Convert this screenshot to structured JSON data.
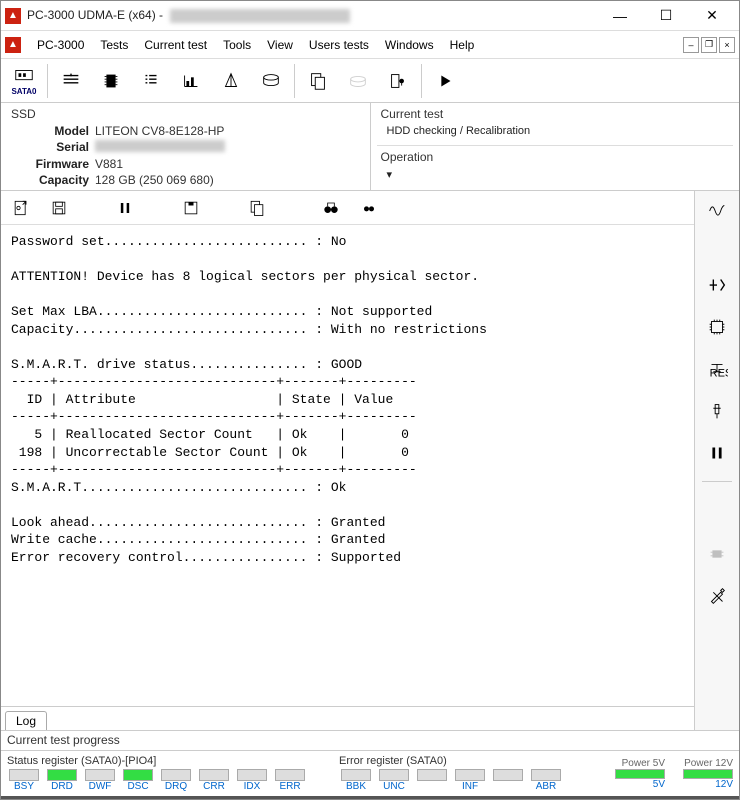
{
  "window": {
    "title_prefix": "PC-3000 UDMA-E (x64) - "
  },
  "menu": {
    "app": "PC-3000",
    "items": [
      "Tests",
      "Current test",
      "Tools",
      "View",
      "Users tests",
      "Windows",
      "Help"
    ]
  },
  "toolbar": {
    "port_label": "SATA0"
  },
  "ssd": {
    "header": "SSD",
    "model_label": "Model",
    "model": "LITEON CV8-8E128-HP",
    "serial_label": "Serial",
    "firmware_label": "Firmware",
    "firmware": "V881",
    "capacity_label": "Capacity",
    "capacity": "128 GB (250 069 680)"
  },
  "current_test": {
    "header": "Current test",
    "value": "HDD checking / Recalibration",
    "operation_label": "Operation",
    "operation_value": "▾"
  },
  "log": {
    "text": "Password set.......................... : No\n\nATTENTION! Device has 8 logical sectors per physical sector.\n\nSet Max LBA........................... : Not supported\nCapacity.............................. : With no restrictions\n\nS.M.A.R.T. drive status............... : GOOD\n-----+----------------------------+-------+---------\n  ID | Attribute                  | State | Value\n-----+----------------------------+-------+---------\n   5 | Reallocated Sector Count   | Ok    |       0\n 198 | Uncorrectable Sector Count | Ok    |       0\n-----+----------------------------+-------+---------\nS.M.A.R.T............................. : Ok\n\nLook ahead............................ : Granted\nWrite cache........................... : Granted\nError recovery control................ : Supported"
  },
  "tabs": {
    "log": "Log"
  },
  "progress": {
    "label": "Current test progress"
  },
  "status_reg": {
    "label": "Status register (SATA0)-[PIO4]",
    "regs": [
      {
        "name": "BSY",
        "on": false
      },
      {
        "name": "DRD",
        "on": true
      },
      {
        "name": "DWF",
        "on": false
      },
      {
        "name": "DSC",
        "on": true
      },
      {
        "name": "DRQ",
        "on": false
      },
      {
        "name": "CRR",
        "on": false
      },
      {
        "name": "IDX",
        "on": false
      },
      {
        "name": "ERR",
        "on": false
      }
    ]
  },
  "error_reg": {
    "label": "Error register (SATA0)",
    "regs": [
      {
        "name": "BBK",
        "on": false
      },
      {
        "name": "UNC",
        "on": false
      },
      {
        "name": "",
        "on": false
      },
      {
        "name": "INF",
        "on": false
      },
      {
        "name": "",
        "on": false
      },
      {
        "name": "ABR",
        "on": false
      }
    ]
  },
  "power": {
    "p5_label": "Power 5V",
    "p5": "5V",
    "p12_label": "Power 12V",
    "p12": "12V"
  }
}
